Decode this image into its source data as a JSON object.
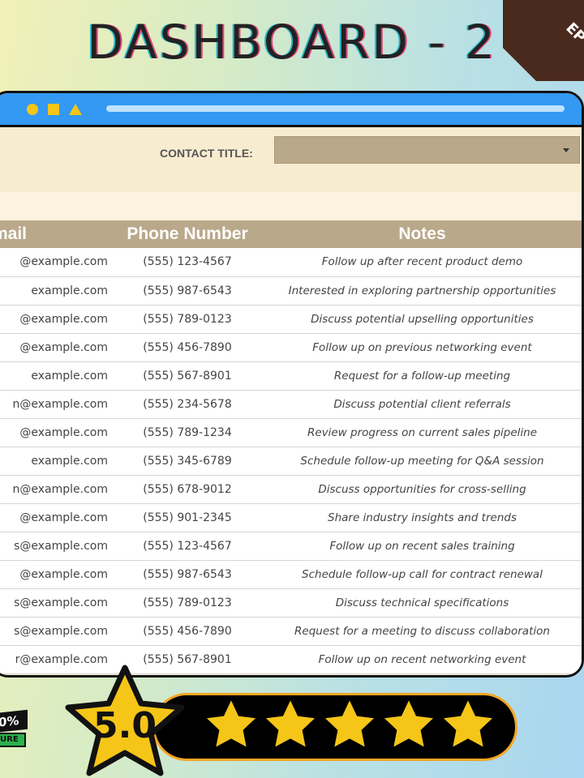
{
  "page_title": "DASHBOARD - 2",
  "corner_badge": "EP",
  "colors": {
    "titlebar": "#3399f3",
    "header": "#b9a98a",
    "star": "#f5c518"
  },
  "filter": {
    "label": "CONTACT TITLE:",
    "value": ""
  },
  "table": {
    "headers": {
      "email": "mail",
      "phone": "Phone Number",
      "notes": "Notes"
    },
    "rows": [
      {
        "email": "@example.com",
        "phone": "(555) 123-4567",
        "notes": "Follow up after recent product demo"
      },
      {
        "email": "example.com",
        "phone": "(555) 987-6543",
        "notes": "Interested in exploring partnership opportunities"
      },
      {
        "email": "@example.com",
        "phone": "(555) 789-0123",
        "notes": "Discuss potential upselling opportunities"
      },
      {
        "email": "@example.com",
        "phone": "(555) 456-7890",
        "notes": "Follow up on previous networking event"
      },
      {
        "email": "example.com",
        "phone": "(555) 567-8901",
        "notes": "Request for a follow-up meeting"
      },
      {
        "email": "n@example.com",
        "phone": "(555) 234-5678",
        "notes": "Discuss potential client referrals"
      },
      {
        "email": "@example.com",
        "phone": "(555) 789-1234",
        "notes": "Review progress on current sales pipeline"
      },
      {
        "email": "example.com",
        "phone": "(555) 345-6789",
        "notes": "Schedule follow-up meeting for Q&A session"
      },
      {
        "email": "n@example.com",
        "phone": "(555) 678-9012",
        "notes": "Discuss opportunities for cross-selling"
      },
      {
        "email": "@example.com",
        "phone": "(555) 901-2345",
        "notes": "Share industry insights and trends"
      },
      {
        "email": "s@example.com",
        "phone": "(555) 123-4567",
        "notes": "Follow up on recent sales training"
      },
      {
        "email": "@example.com",
        "phone": "(555) 987-6543",
        "notes": "Schedule follow-up call for contract renewal"
      },
      {
        "email": "s@example.com",
        "phone": "(555) 789-0123",
        "notes": "Discuss technical specifications"
      },
      {
        "email": "s@example.com",
        "phone": "(555) 456-7890",
        "notes": "Request for a meeting to discuss collaboration"
      },
      {
        "email": "r@example.com",
        "phone": "(555) 567-8901",
        "notes": "Follow up on recent networking event"
      }
    ]
  },
  "badge_left": {
    "line1": "0%",
    "line2": "URE"
  },
  "rating": {
    "score": "5.0",
    "stars": 5
  }
}
